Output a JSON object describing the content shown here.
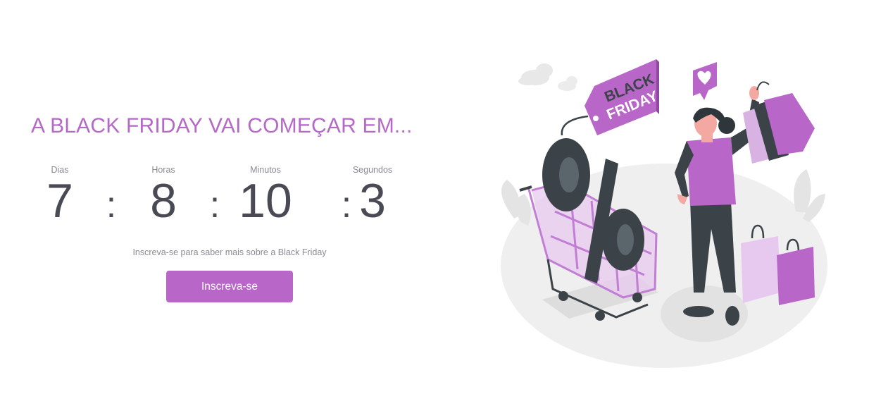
{
  "headline": "A BLACK FRIDAY VAI COMEÇAR EM...",
  "countdown": {
    "days_label": "Dias",
    "days_value": "7",
    "hours_label": "Horas",
    "hours_value": "8",
    "minutes_label": "Minutos",
    "minutes_value": "10",
    "seconds_label": "Segundos",
    "seconds_value": "3",
    "separator": ":"
  },
  "subtitle": "Inscreva-se para saber mais sobre a Black Friday",
  "cta_label": "Inscreva-se",
  "illustration": {
    "tag_line1": "BLACK",
    "tag_line2": "FRIDAY",
    "percent_symbol": "%"
  },
  "colors": {
    "accent": "#b867c9",
    "headline": "#b569c7",
    "digits": "#4a4a55",
    "muted": "#8a8a94",
    "dark": "#3b4348"
  }
}
